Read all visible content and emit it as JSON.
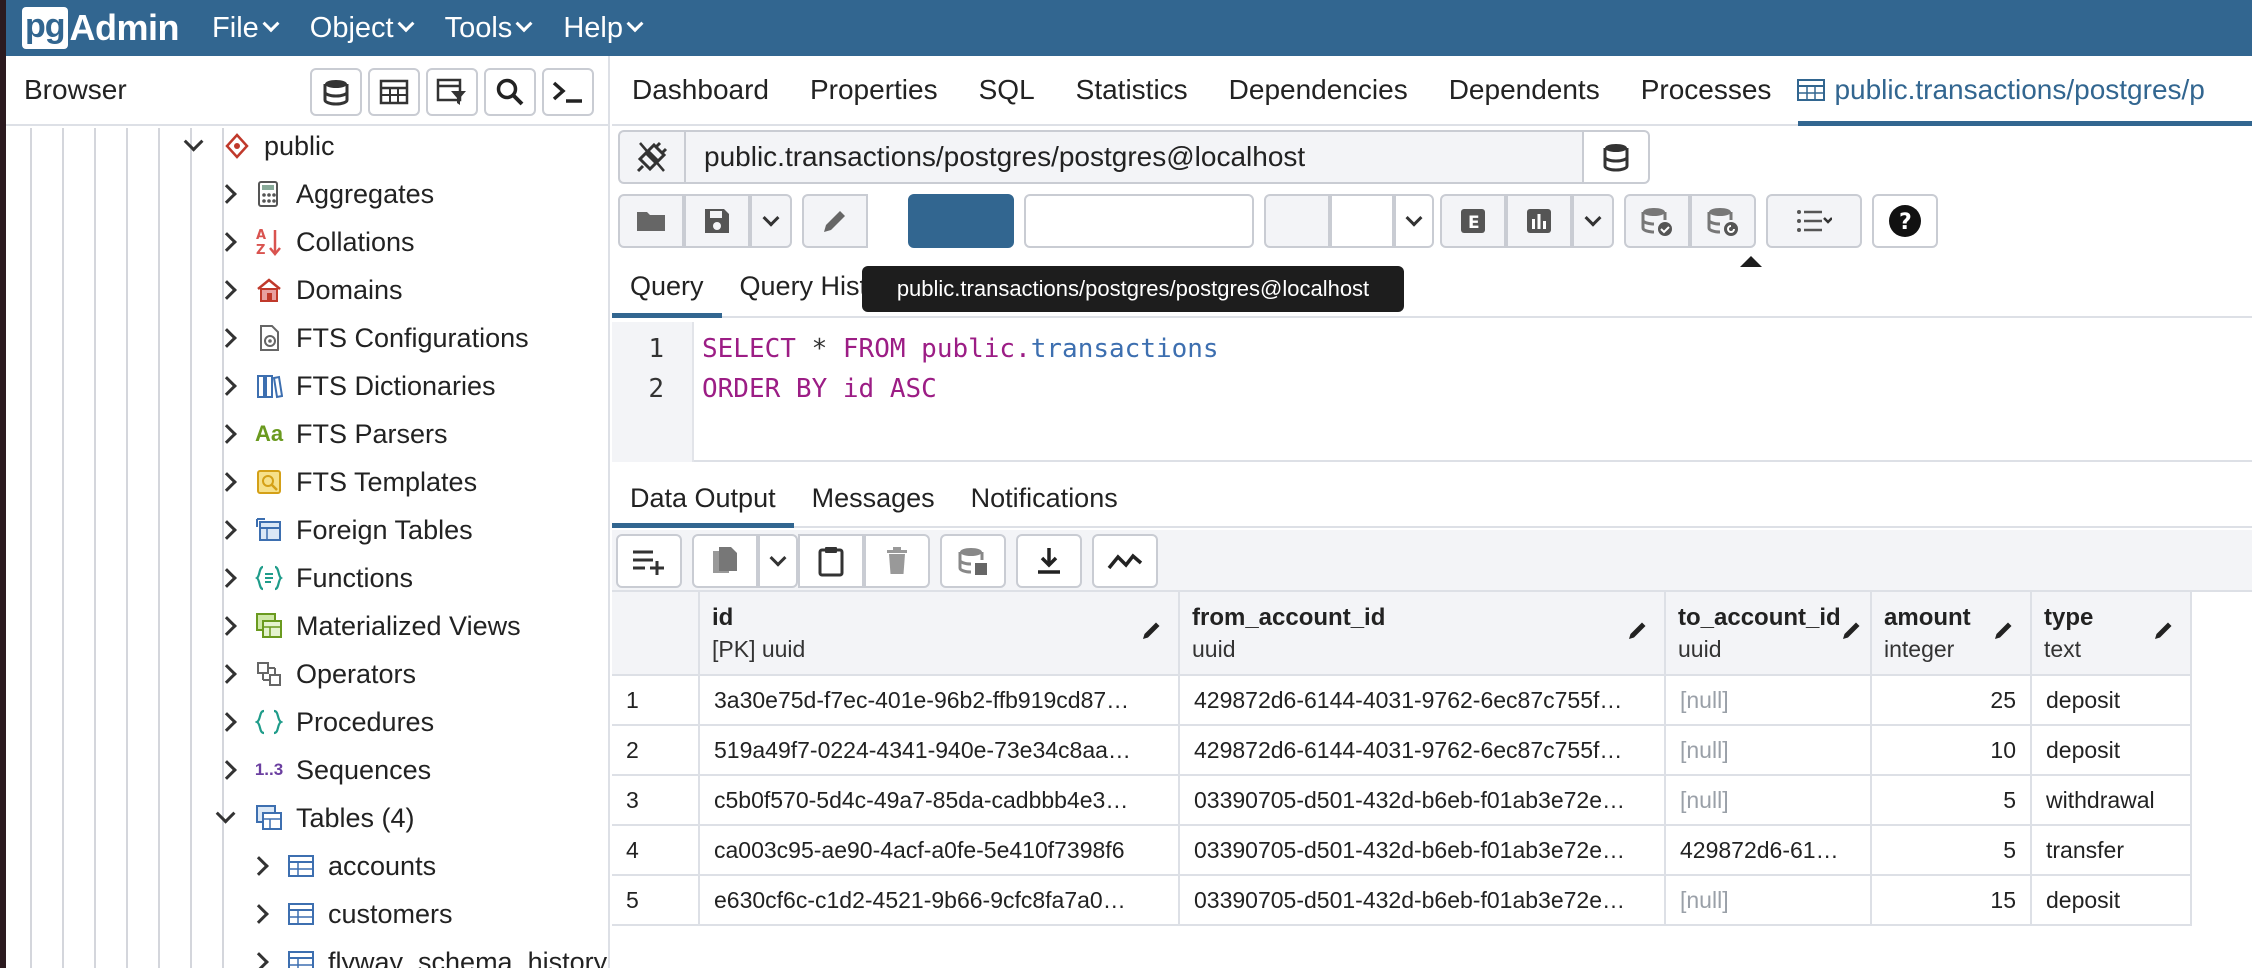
{
  "app": {
    "logo_pg": "pg",
    "logo_admin": "Admin",
    "menus": [
      "File",
      "Object",
      "Tools",
      "Help"
    ]
  },
  "browser": {
    "title": "Browser",
    "tree": [
      {
        "label": "public",
        "icon": "schema-icon",
        "expanded": true
      },
      {
        "label": "Aggregates",
        "icon": "aggregate-icon"
      },
      {
        "label": "Collations",
        "icon": "collation-icon"
      },
      {
        "label": "Domains",
        "icon": "domain-icon"
      },
      {
        "label": "FTS Configurations",
        "icon": "fts-config-icon"
      },
      {
        "label": "FTS Dictionaries",
        "icon": "fts-dictionary-icon"
      },
      {
        "label": "FTS Parsers",
        "icon": "fts-parser-icon",
        "glyph": "Aa"
      },
      {
        "label": "FTS Templates",
        "icon": "fts-template-icon"
      },
      {
        "label": "Foreign Tables",
        "icon": "foreign-table-icon"
      },
      {
        "label": "Functions",
        "icon": "function-icon"
      },
      {
        "label": "Materialized Views",
        "icon": "mview-icon"
      },
      {
        "label": "Operators",
        "icon": "operator-icon"
      },
      {
        "label": "Procedures",
        "icon": "procedure-icon"
      },
      {
        "label": "Sequences",
        "icon": "sequence-icon",
        "glyph": "1..3"
      },
      {
        "label": "Tables (4)",
        "icon": "tables-icon",
        "expanded": true
      },
      {
        "label": "accounts",
        "icon": "table-icon"
      },
      {
        "label": "customers",
        "icon": "table-icon"
      },
      {
        "label": "flyway_schema_history",
        "icon": "table-icon"
      }
    ]
  },
  "main": {
    "tabs": [
      "Dashboard",
      "Properties",
      "SQL",
      "Statistics",
      "Dependencies",
      "Dependents",
      "Processes"
    ],
    "active_tab": "public.transactions/postgres/p",
    "connection": "public.transactions/postgres/postgres@localhost",
    "tooltip": "public.transactions/postgres/postgres@localhost",
    "query_tabs": [
      "Query",
      "Query History"
    ],
    "editor": {
      "line_numbers": [
        "1",
        "2"
      ],
      "line1": {
        "kw1": "SELECT",
        "star": " * ",
        "kw2": "FROM",
        "schema": " public.",
        "table": "transactions"
      },
      "line2": {
        "kw1": "ORDER BY",
        "col": " id ",
        "kw2": "ASC"
      }
    },
    "output_tabs": [
      "Data Output",
      "Messages",
      "Notifications"
    ]
  },
  "grid": {
    "columns": [
      {
        "name": "id",
        "type": "[PK] uuid"
      },
      {
        "name": "from_account_id",
        "type": "uuid"
      },
      {
        "name": "to_account_id",
        "type": "uuid"
      },
      {
        "name": "amount",
        "type": "integer"
      },
      {
        "name": "type",
        "type": "text"
      }
    ],
    "rows": [
      {
        "n": "1",
        "id": "3a30e75d-f7ec-401e-96b2-ffb919cd87…",
        "from": "429872d6-6144-4031-9762-6ec87c755f…",
        "to": "[null]",
        "amount": "25",
        "type": "deposit"
      },
      {
        "n": "2",
        "id": "519a49f7-0224-4341-940e-73e34c8aa…",
        "from": "429872d6-6144-4031-9762-6ec87c755f…",
        "to": "[null]",
        "amount": "10",
        "type": "deposit"
      },
      {
        "n": "3",
        "id": "c5b0f570-5d4c-49a7-85da-cadbbb4e3…",
        "from": "03390705-d501-432d-b6eb-f01ab3e72e…",
        "to": "[null]",
        "amount": "5",
        "type": "withdrawal"
      },
      {
        "n": "4",
        "id": "ca003c95-ae90-4acf-a0fe-5e410f7398f6",
        "from": "03390705-d501-432d-b6eb-f01ab3e72e…",
        "to": "429872d6-61…",
        "amount": "5",
        "type": "transfer"
      },
      {
        "n": "5",
        "id": "e630cf6c-c1d2-4521-9b66-9cfc8fa7a0…",
        "from": "03390705-d501-432d-b6eb-f01ab3e72e…",
        "to": "[null]",
        "amount": "15",
        "type": "deposit"
      }
    ]
  },
  "colors": {
    "brand": "#326690",
    "null_text": "#9aa0a8",
    "keyword": "#9c1d85",
    "table_name": "#3d6fb0"
  }
}
